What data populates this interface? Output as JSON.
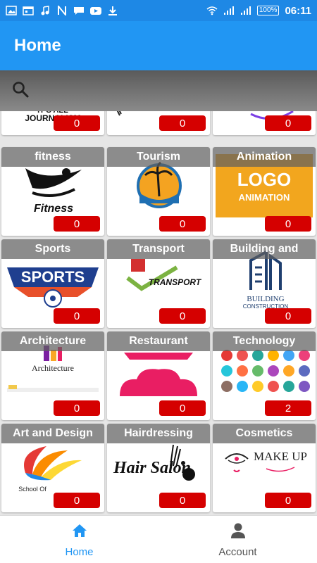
{
  "status_bar": {
    "time": "06:11",
    "battery": "100%",
    "icons": [
      "image-icon",
      "calendar-icon",
      "music-icon",
      "n-icon",
      "message-icon",
      "youtube-icon",
      "download-icon",
      "wifi-icon",
      "signal-icon",
      "signal-icon-2"
    ]
  },
  "app_bar": {
    "title": "Home"
  },
  "search": {
    "icon": "search-icon"
  },
  "partial_row": [
    {
      "label": "0",
      "art": "It's All Journalism"
    },
    {
      "label": "0",
      "art": "figure"
    },
    {
      "label": "0",
      "art": "arc"
    }
  ],
  "categories": [
    {
      "title": "fitness",
      "count": "0",
      "logo_text": "Fitness"
    },
    {
      "title": "Tourism",
      "count": "0",
      "logo_text": ""
    },
    {
      "title": "Animation",
      "count": "0",
      "logo_text": "LOGO ANIMATION"
    },
    {
      "title": "Sports",
      "count": "0",
      "logo_text": "SPORTS"
    },
    {
      "title": "Transport",
      "count": "0",
      "logo_text": "TRANSPORT"
    },
    {
      "title": "Building and",
      "count": "0",
      "logo_text": "BUILDING CONSTRUCTION"
    },
    {
      "title": "Architecture",
      "count": "0",
      "logo_text": "Architecture"
    },
    {
      "title": "Restaurant",
      "count": "0",
      "logo_text": ""
    },
    {
      "title": "Technology",
      "count": "2",
      "logo_text": ""
    },
    {
      "title": "Art and Design",
      "count": "0",
      "logo_text": "School Of"
    },
    {
      "title": "Hairdressing",
      "count": "0",
      "logo_text": "Hair Salon"
    },
    {
      "title": "Cosmetics",
      "count": "0",
      "logo_text": "MAKE UP"
    }
  ],
  "bottom_nav": {
    "items": [
      {
        "label": "Home",
        "icon": "home-icon",
        "active": true
      },
      {
        "label": "Account",
        "icon": "account-icon",
        "active": false
      }
    ]
  },
  "colors": {
    "primary": "#2196f3",
    "status_bar": "#1e88e5",
    "badge": "#d50000"
  }
}
